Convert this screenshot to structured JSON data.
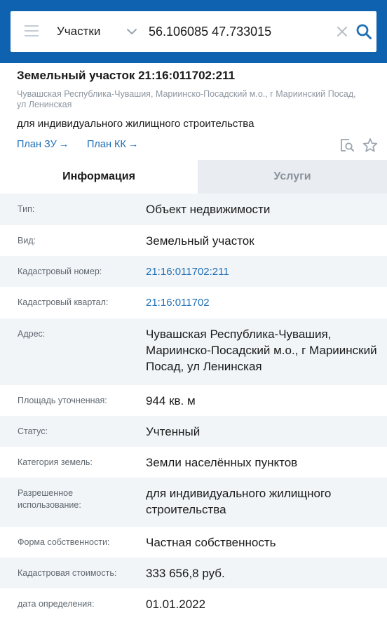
{
  "colors": {
    "topbar": "#0f62b0",
    "link": "#1f6fb6",
    "accent_icon": "#1f6fb6",
    "shaded_row": "#f2f5f8"
  },
  "search": {
    "layer_selected": "Участки",
    "query_value": "56.106085 47.733015",
    "icons": [
      "menu-icon",
      "chevron-down-icon",
      "clear-icon",
      "search-icon"
    ]
  },
  "object": {
    "title": "Земельный участок 21:16:011702:211",
    "address": "Чувашская Республика-Чувашия, Мариинско-Посадский м.о., г Мариинский Посад, ул Ленинская",
    "usage": "для индивидуального жилищного строительства",
    "links": {
      "plan_zu": "План ЗУ",
      "plan_kk": "План КК",
      "arrow": "→"
    },
    "icons": [
      "document-search-icon",
      "star-icon"
    ]
  },
  "tabs": {
    "info": "Информация",
    "services": "Услуги",
    "active": "info"
  },
  "info_rows": [
    {
      "label": "Тип:",
      "value": "Объект недвижимости"
    },
    {
      "label": "Вид:",
      "value": "Земельный участок"
    },
    {
      "label": "Кадастровый номер:",
      "value": "21:16:011702:211"
    },
    {
      "label": "Кадастровый квартал:",
      "value": "21:16:011702"
    },
    {
      "label": "Адрес:",
      "value": "Чувашская Республика-Чувашия, Мариинско-Посадский м.о., г Мариинский Посад, ул Ленинская"
    },
    {
      "label": "Площадь уточненная:",
      "value": "944 кв. м"
    },
    {
      "label": "Статус:",
      "value": "Учтенный"
    },
    {
      "label": "Категория земель:",
      "value": "Земли населённых пунктов"
    },
    {
      "label": "Разрешенное использование:",
      "value": "для индивидуального жилищного строительства"
    },
    {
      "label": "Форма собственности:",
      "value": "Частная собственность"
    },
    {
      "label": "Кадастровая стоимость:",
      "value": "333 656,8 руб."
    },
    {
      "label": "дата определения:",
      "value": "01.01.2022"
    }
  ]
}
